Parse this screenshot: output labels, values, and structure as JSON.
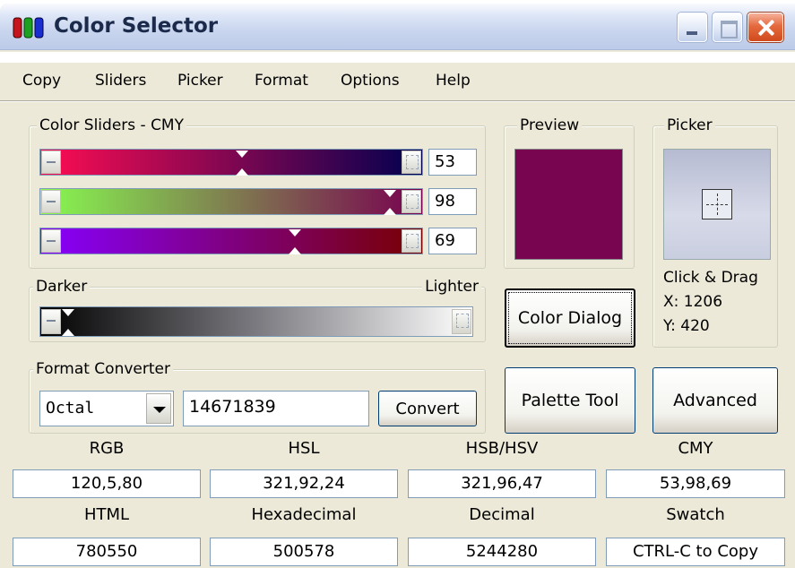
{
  "window": {
    "title": "Color Selector"
  },
  "menu": [
    "Copy",
    "Sliders",
    "Picker",
    "Format",
    "Options",
    "Help"
  ],
  "sliders_group": {
    "label": "Color Sliders - CMY",
    "sliders": [
      {
        "value": "53",
        "level": 0.53,
        "gradient": [
          "#ff0d52",
          "#000050"
        ]
      },
      {
        "value": "98",
        "level": 0.98,
        "gradient": [
          "#87fa50",
          "#780050"
        ]
      },
      {
        "value": "69",
        "level": 0.69,
        "gradient": [
          "#8700ff",
          "#780000"
        ]
      }
    ]
  },
  "preview": {
    "label": "Preview",
    "color": "#780550"
  },
  "picker": {
    "label": "Picker",
    "hint": "Click & Drag",
    "x_label": "X: 1206",
    "y_label": "Y: 420"
  },
  "brightness": {
    "left_label": "Darker",
    "right_label": "Lighter",
    "level": 0.0
  },
  "color_dialog_button": "Color Dialog",
  "format_converter": {
    "label": "Format Converter",
    "format_selected": "Octal",
    "input_value": "14671839",
    "convert_button": "Convert"
  },
  "palette_tool_button": "Palette Tool",
  "advanced_button": "Advanced",
  "formats_row1": [
    {
      "label": "RGB",
      "value": "120,5,80"
    },
    {
      "label": "HSL",
      "value": "321,92,24"
    },
    {
      "label": "HSB/HSV",
      "value": "321,96,47"
    },
    {
      "label": "CMY",
      "value": "53,98,69"
    }
  ],
  "formats_row2": [
    {
      "label": "HTML",
      "value": "780550"
    },
    {
      "label": "Hexadecimal",
      "value": "500578"
    },
    {
      "label": "Decimal",
      "value": "5244280"
    },
    {
      "label": "Swatch",
      "value": "CTRL-C to Copy"
    }
  ]
}
